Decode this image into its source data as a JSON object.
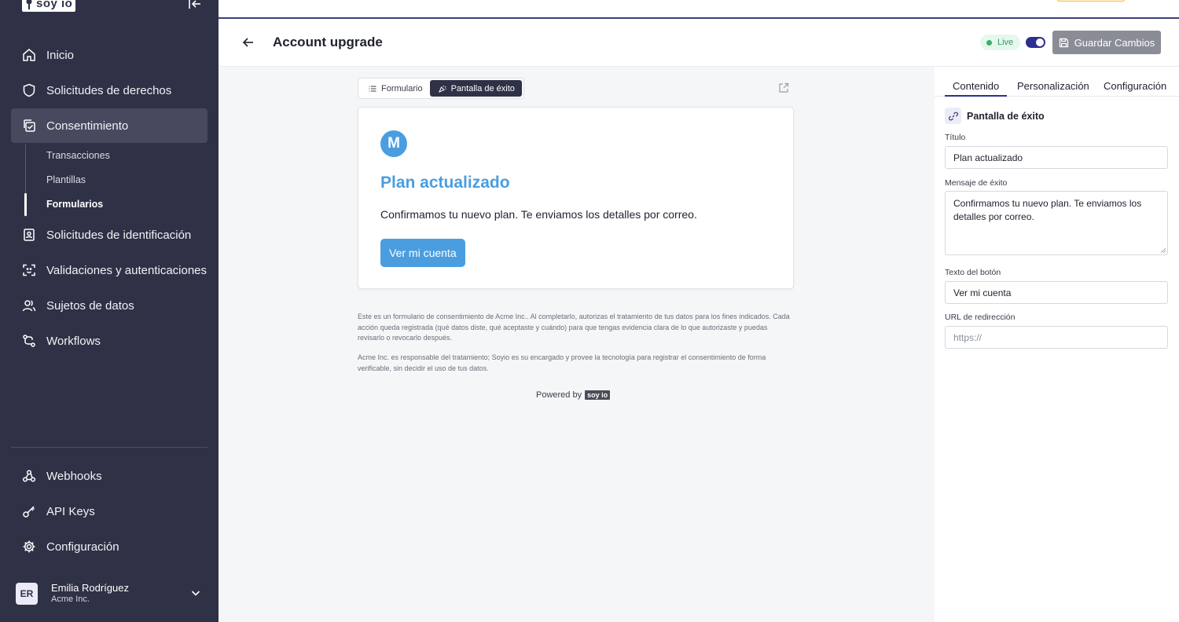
{
  "sidebar": {
    "logo_text": "soy io",
    "nav": [
      {
        "label": "Inicio"
      },
      {
        "label": "Solicitudes de derechos"
      },
      {
        "label": "Consentimiento"
      },
      {
        "label": "Solicitudes de identificación"
      },
      {
        "label": "Validaciones y autenticaciones"
      },
      {
        "label": "Sujetos de datos"
      },
      {
        "label": "Workflows"
      }
    ],
    "sub": [
      {
        "label": "Transacciones"
      },
      {
        "label": "Plantillas"
      },
      {
        "label": "Formularios"
      }
    ],
    "bottom": [
      {
        "label": "Webhooks"
      },
      {
        "label": "API Keys"
      },
      {
        "label": "Configuración"
      }
    ],
    "user": {
      "initials": "ER",
      "name": "Emilia Rodríguez",
      "org": "Acme Inc."
    }
  },
  "header": {
    "title": "Account upgrade",
    "live": "Live",
    "save": "Guardar Cambios"
  },
  "preview": {
    "tabs": [
      {
        "label": "Formulario"
      },
      {
        "label": "Pantalla de éxito"
      }
    ],
    "brand_initial": "M",
    "title": "Plan actualizado",
    "message": "Confirmamos tu nuevo plan. Te enviamos los detalles por correo.",
    "button": "Ver mi cuenta",
    "legal_1": "Este es un formulario de consentimiento de Acme Inc.. Al completarlo, autorizas el tratamiento de tus datos para los fines indicados. Cada acción queda registrada (qué datos diste, qué aceptaste y cuándo) para que tengas evidencia clara de lo que autorizaste y puedas revisarlo o revocarlo después.",
    "legal_2": "Acme Inc. es responsable del tratamiento; Soyio es su encargado y provee la tecnología para registrar el consentimiento de forma verificable, sin decidir el uso de tus datos.",
    "powered_by": "Powered by",
    "powered_logo": "soy io"
  },
  "panel": {
    "tabs": [
      {
        "label": "Contenido"
      },
      {
        "label": "Personalización"
      },
      {
        "label": "Configuración"
      }
    ],
    "section": "Pantalla de éxito",
    "fields": {
      "title_label": "Título",
      "title_value": "Plan actualizado",
      "message_label": "Mensaje de éxito",
      "message_value": "Confirmamos tu nuevo plan. Te enviamos los detalles por correo.",
      "button_label": "Texto del botón",
      "button_value": "Ver mi cuenta",
      "url_label": "URL de redirección",
      "url_placeholder": "https://"
    }
  },
  "colors": {
    "sidebar_bg": "#2f3146",
    "accent": "#2f2f8f",
    "brand_blue": "#4a9ee0",
    "live_green": "#33b26b"
  }
}
